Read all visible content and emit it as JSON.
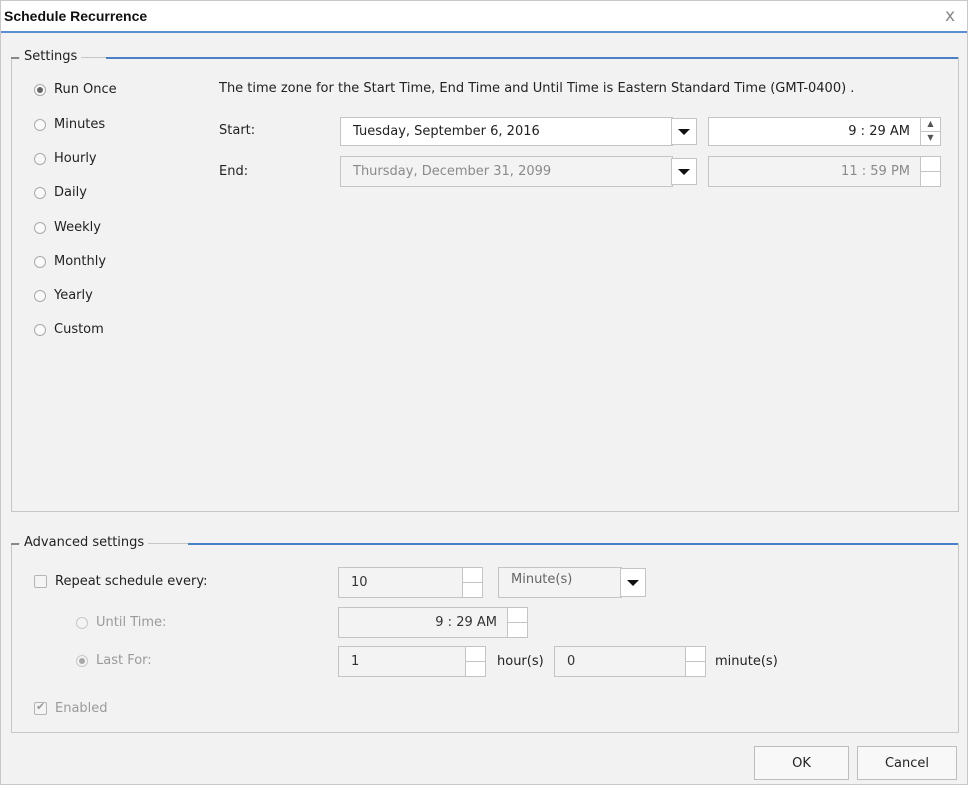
{
  "dialog": {
    "title": "Schedule Recurrence",
    "close_glyph": "x"
  },
  "settings": {
    "legend": "Settings",
    "recurrence_options": [
      {
        "label": "Run Once",
        "checked": true
      },
      {
        "label": "Minutes",
        "checked": false
      },
      {
        "label": "Hourly",
        "checked": false
      },
      {
        "label": "Daily",
        "checked": false
      },
      {
        "label": "Weekly",
        "checked": false
      },
      {
        "label": "Monthly",
        "checked": false
      },
      {
        "label": "Yearly",
        "checked": false
      },
      {
        "label": "Custom",
        "checked": false
      }
    ],
    "timezone_note": "The time zone for the Start Time, End Time and Until Time is Eastern Standard Time (GMT-0400) .",
    "start": {
      "label": "Start:",
      "date": "Tuesday, September 6, 2016",
      "hour": "9",
      "minute": "29",
      "ampm": "AM"
    },
    "end": {
      "label": "End:",
      "date": "Thursday, December 31, 2099",
      "hour": "11",
      "minute": "59",
      "ampm": "PM"
    }
  },
  "advanced": {
    "legend": "Advanced settings",
    "repeat": {
      "label": "Repeat schedule every:",
      "checked": false,
      "value": "10",
      "unit": "Minute(s)"
    },
    "until_time": {
      "label": "Until Time:",
      "hour": "9",
      "minute": "29",
      "ampm": "AM"
    },
    "last_for": {
      "label": "Last For:",
      "hours": "1",
      "hours_unit": "hour(s)",
      "minutes": "0",
      "minutes_unit": "minute(s)"
    },
    "enabled": {
      "label": "Enabled",
      "checked": true
    }
  },
  "buttons": {
    "ok": "OK",
    "cancel": "Cancel"
  },
  "icons": {
    "close": "close-icon",
    "dropdown": "chevron-down-icon",
    "spinner": "spinner-icon"
  },
  "colors": {
    "accent": "#4a80c8",
    "background": "#f2f2f2"
  }
}
